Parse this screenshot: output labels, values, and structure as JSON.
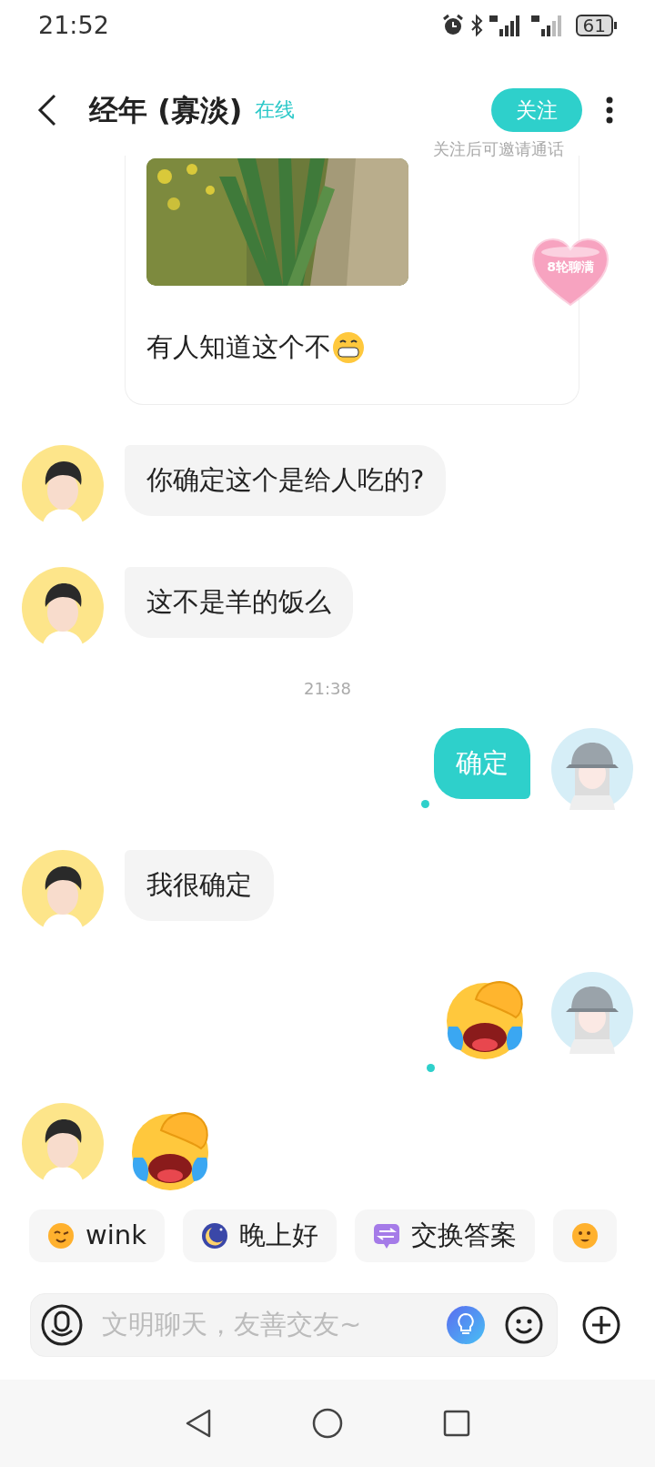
{
  "status_bar": {
    "time": "21:52",
    "battery": "61"
  },
  "header": {
    "title": "经年 (寡淡)",
    "presence": "在线",
    "follow_button": "关注",
    "follow_hint": "关注后可邀请通话"
  },
  "badge": {
    "label": "8轮聊满"
  },
  "messages": [
    {
      "kind": "image_post",
      "outgoing": false,
      "text": "有人知道这个不"
    },
    {
      "kind": "text",
      "outgoing": false,
      "text": "你确定这个是给人吃的?"
    },
    {
      "kind": "text",
      "outgoing": false,
      "text": "这不是羊的饭么"
    },
    {
      "kind": "time",
      "text": "21:38"
    },
    {
      "kind": "text",
      "outgoing": true,
      "text": "确定",
      "unread_dot": true
    },
    {
      "kind": "text",
      "outgoing": false,
      "text": "我很确定"
    },
    {
      "kind": "emoji",
      "outgoing": true,
      "unread_dot": true
    },
    {
      "kind": "emoji",
      "outgoing": false
    }
  ],
  "quick_replies": [
    {
      "kind": "wink",
      "label": "wink"
    },
    {
      "kind": "moon",
      "label": "晚上好"
    },
    {
      "kind": "swap",
      "label": "交换答案"
    },
    {
      "kind": "voice"
    }
  ],
  "composer": {
    "placeholder": "文明聊天，友善交友~"
  }
}
